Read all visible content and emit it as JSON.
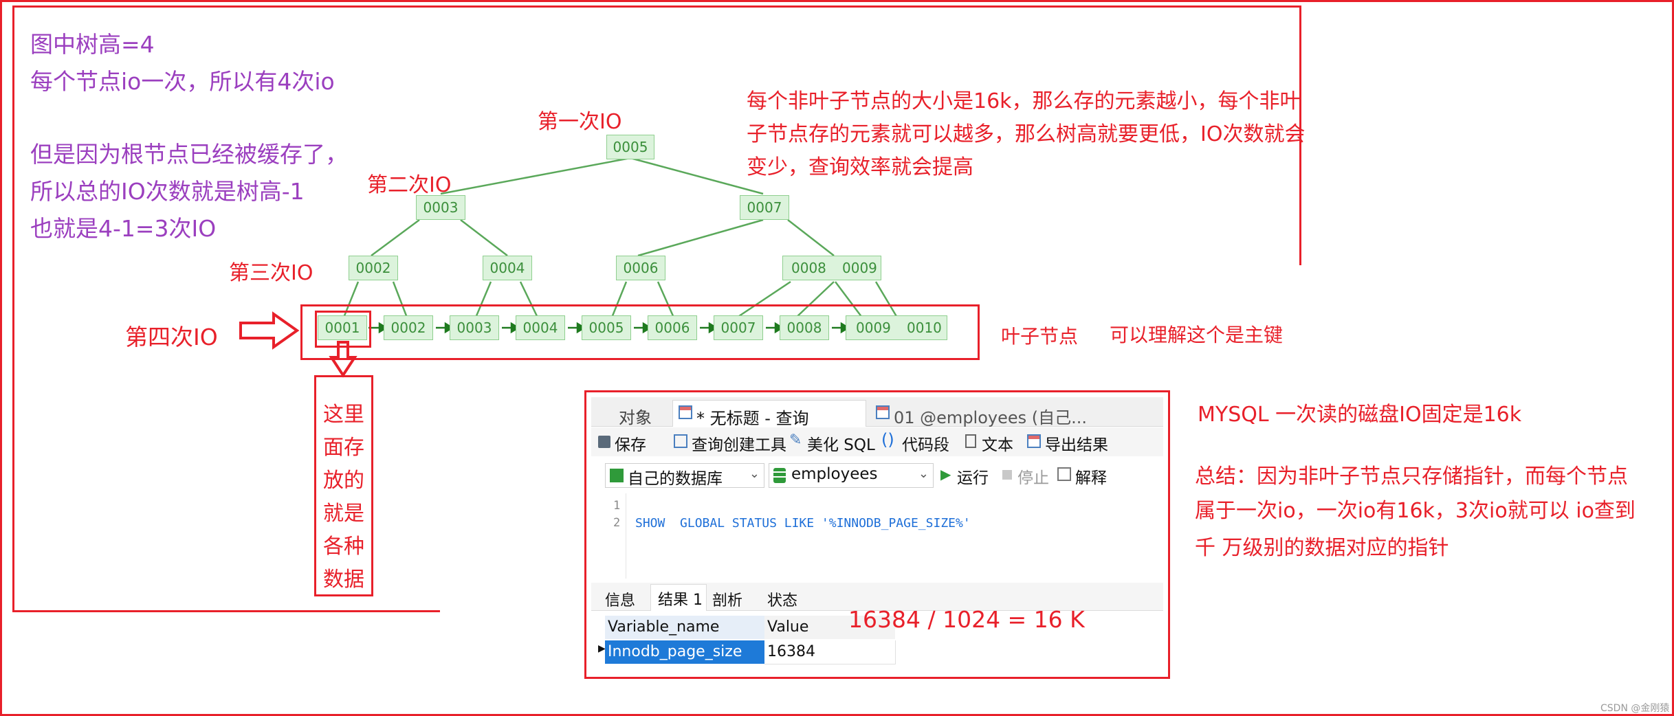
{
  "notes": {
    "tree_height": "图中树高=4",
    "io_per_node": "每个节点io一次，所以有4次io",
    "cached_line1": "但是因为根节点已经被缓存了，",
    "cached_line2": "所以总的IO次数就是树高-1",
    "cached_line3": "也就是4-1=3次IO",
    "page_size_line1": "每个非叶子节点的大小是16k，那么存的元素越小，每个非叶",
    "page_size_line2": "子节点存的元素就可以越多，那么树高就要更低，IO次数就会",
    "page_size_line3": "变少，查询效率就会提高",
    "mysql_io": "MYSQL 一次读的磁盘IO固定是16k",
    "summary_line1": "总结：因为非叶子节点只存储指针，而每个节点",
    "summary_line2": "属于一次io，一次io有16k，3次io就可以 io查到",
    "summary_line3": "千 万级别的数据对应的指针",
    "calc": "16384 / 1024 = 16 K",
    "leaf_label": "叶子节点",
    "pk_label": "可以理解这个是主键",
    "storage_label": [
      "这里",
      "面存",
      "放的",
      "就是",
      "各种",
      "数据"
    ],
    "watermark": "CSDN @金刚猿"
  },
  "levels": {
    "io1": "第一次IO",
    "io2": "第二次IO",
    "io3": "第三次IO",
    "io4": "第四次IO"
  },
  "tree": {
    "root": "0005",
    "level2": [
      "0003",
      "0007"
    ],
    "level3": [
      "0002",
      "0004",
      "0006",
      "0008",
      "0009"
    ],
    "leaves": [
      "0001",
      "0002",
      "0003",
      "0004",
      "0005",
      "0006",
      "0007",
      "0008",
      "0009",
      "0010"
    ]
  },
  "navicat": {
    "tabs": [
      "对象",
      "* 无标题 - 查询",
      "01 @employees (自己..."
    ],
    "toolbar": {
      "save": "保存",
      "query_builder": "查询创建工具",
      "beautify": "美化 SQL",
      "code_snippet": "代码段",
      "text": "文本",
      "export": "导出结果"
    },
    "connection": "自己的数据库",
    "database": "employees",
    "run": "运行",
    "stop": "停止",
    "explain": "解释",
    "line_numbers": [
      "1",
      "2"
    ],
    "sql": "SHOW  GLOBAL STATUS LIKE '%INNODB_PAGE_SIZE%'",
    "result_tabs": [
      "信息",
      "结果 1",
      "剖析",
      "状态"
    ],
    "columns": [
      "Variable_name",
      "Value"
    ],
    "rows": [
      [
        "Innodb_page_size",
        "16384"
      ]
    ]
  },
  "colors": {
    "annotation_red": "#e8202a",
    "annotation_purple": "#9b3fbf",
    "node_green": "#3b8f3b",
    "selected_blue": "#1e7ad8"
  }
}
